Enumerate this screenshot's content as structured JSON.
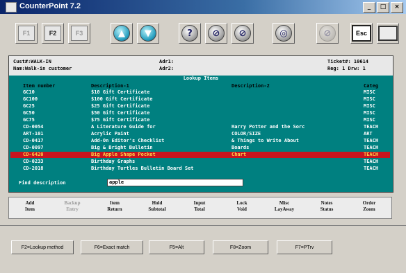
{
  "window": {
    "title": "CounterPoint 7.2",
    "buttons": [
      "_",
      "□",
      "×"
    ]
  },
  "toolbar": {
    "f1": "F1",
    "f2": "F2",
    "f3": "F3",
    "help": "?",
    "esc": "Esc"
  },
  "header": {
    "cust_line": "Cust#:WALK-IN",
    "name_line": "Nam:Walk-in customer",
    "adr1": "Adr1:",
    "adr2": "Adr2:",
    "ticket": "Ticket#:  10614",
    "reg": "Reg:  1  Drw:  1"
  },
  "lookup": {
    "title": "Lookup Items",
    "columns": {
      "item": "Item number",
      "desc1": "Description-1",
      "desc2": "Description-2",
      "categ": "Categ"
    },
    "rows": [
      {
        "item": "GC10",
        "desc1": "$10 Gift Certificate",
        "desc2": "",
        "categ": "MISC"
      },
      {
        "item": "GC100",
        "desc1": "$100 Gift Certificate",
        "desc2": "",
        "categ": "MISC"
      },
      {
        "item": "GC25",
        "desc1": "$25 Gift Certificate",
        "desc2": "",
        "categ": "MISC"
      },
      {
        "item": "GC50",
        "desc1": "$50 Gift Certificate",
        "desc2": "",
        "categ": "MISC"
      },
      {
        "item": "GC75",
        "desc1": "$75 Gift Certificate",
        "desc2": "",
        "categ": "MISC"
      },
      {
        "item": "CD-0054",
        "desc1": "A Literature Guide for",
        "desc2": "Harry Potter and the Sorc",
        "categ": "TEACH"
      },
      {
        "item": "ART-101",
        "desc1": "Acrylic Paint",
        "desc2": "COLOR/SIZE",
        "categ": "ART"
      },
      {
        "item": "CD-0417",
        "desc1": "Add-On Editor's Checklist",
        "desc2": "& Things to Write About",
        "categ": "TEACH"
      },
      {
        "item": "CD-0097",
        "desc1": "Big & Bright Bulletin",
        "desc2": "Boards",
        "categ": "TEACH"
      },
      {
        "item": "CD-6420",
        "desc1": "Big Apple Shape Pocket",
        "desc2": "Chart",
        "categ": "TEACH",
        "selected": true
      },
      {
        "item": "CD-0233",
        "desc1": "Birthday Graphs",
        "desc2": "",
        "categ": "TEACH"
      },
      {
        "item": "CD-2018",
        "desc1": "Birthday Turtles Bulletin Board Set",
        "desc2": "",
        "categ": "TEACH"
      }
    ],
    "find_label": "Find description",
    "find_value": "apple"
  },
  "fkeys": [
    {
      "top": "Add",
      "bottom": "Item",
      "dim": false
    },
    {
      "top": "Backup",
      "bottom": "Entry",
      "dim": true
    },
    {
      "top": "Item",
      "bottom": "Return",
      "dim": false
    },
    {
      "top": "Hold",
      "bottom": "Subtotal",
      "dim": false
    },
    {
      "top": "Input",
      "bottom": "Total",
      "dim": false
    },
    {
      "top": "Lock",
      "bottom": "Void",
      "dim": false
    },
    {
      "top": "Misc",
      "bottom": "LayAway",
      "dim": false
    },
    {
      "top": "Notes",
      "bottom": "Status",
      "dim": false
    },
    {
      "top": "Order",
      "bottom": "Zoom",
      "dim": false
    }
  ],
  "bottom_buttons": [
    "F2=Lookup method",
    "F6=Exact match",
    "F5=Alt",
    "F8=Zoom",
    "F7=PTrv"
  ]
}
